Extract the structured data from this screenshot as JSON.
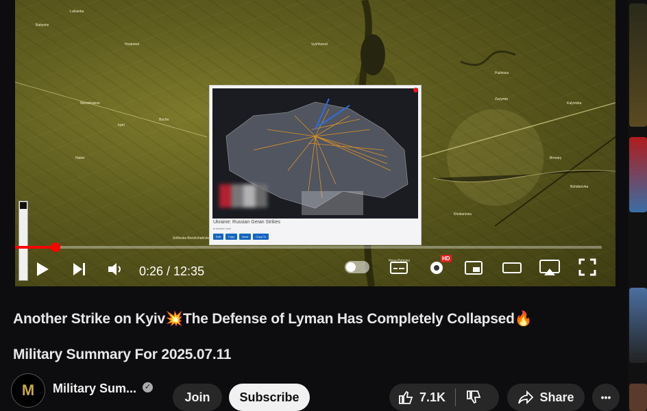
{
  "video": {
    "current_time": "0:26",
    "duration": "12:35",
    "time_display": "0:26 / 12:35",
    "progress_fraction": 0.034,
    "hd_badge": "HD",
    "inset_caption": "Ukraine: Russian Geran Strikes",
    "inset_sub": "● western wall",
    "inset_buttons": [
      "Edit",
      "Copy",
      "More",
      "Copy To"
    ],
    "map_labels": [
      {
        "text": "Lubianka"
      },
      {
        "text": "Babyntsi"
      },
      {
        "text": "Hostomel"
      },
      {
        "text": "Nemishaieve"
      },
      {
        "text": "Irpin"
      },
      {
        "text": "Bucha"
      },
      {
        "text": "Hatne"
      },
      {
        "text": "Sofiivska Borshchahivka"
      },
      {
        "text": "Vyshhorod"
      },
      {
        "text": "Pukhivka"
      },
      {
        "text": "Zazymia"
      },
      {
        "text": "Kalynivka"
      },
      {
        "text": "Brovary"
      },
      {
        "text": "Bohdanivka"
      },
      {
        "text": "Khotianivka"
      },
      {
        "text": "Nova Petrivtsi"
      }
    ]
  },
  "title": {
    "part1": "Another Strike on Kyiv",
    "emoji1": "💥",
    "part2": "The Defense of Lyman Has Completely Collapsed",
    "emoji2": "🔥",
    "part3": "Military Summary For 2025.07.11"
  },
  "channel": {
    "name": "Military Sum...",
    "avatar_letter": "M",
    "verified_icon": "verified-check-icon"
  },
  "actions": {
    "join_label": "Join",
    "subscribe_label": "Subscribe",
    "like_count": "7.1K",
    "share_label": "Share",
    "more_label": "•••"
  },
  "colors": {
    "progress": "#ff0000",
    "accent_blue": "#1565c0"
  }
}
